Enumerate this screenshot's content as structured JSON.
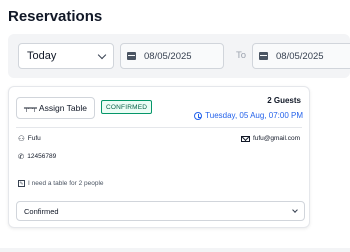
{
  "page": {
    "title": "Reservations"
  },
  "filters": {
    "period_selected": "Today",
    "date_from": "08/05/2025",
    "to_label": "To",
    "date_to": "08/05/2025"
  },
  "reservation": {
    "assign_label": "Assign Table",
    "status_badge": "CONFIRMED",
    "guests": "2 Guests",
    "datetime": "Tuesday, 05 Aug, 07:00 PM",
    "guest_name": "Fufu",
    "email": "fufu@gmail.com",
    "phone": "12456789",
    "note": "I need a table for 2 people",
    "status_selected": "Confirmed"
  },
  "colors": {
    "accent_blue": "#2563eb",
    "badge_green": "#059669",
    "filter_bg": "#f3f4f6"
  }
}
